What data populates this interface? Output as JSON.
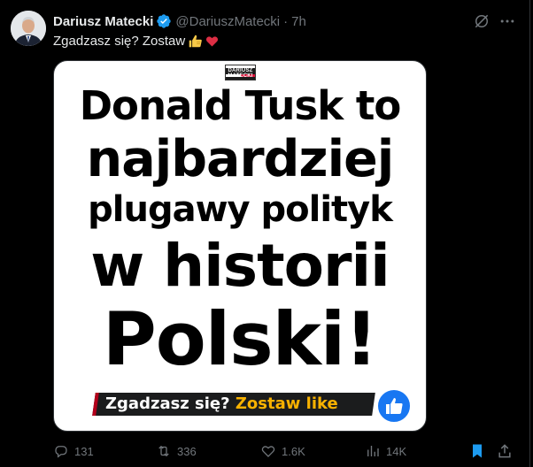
{
  "tweet": {
    "author_name": "Dariusz Matecki",
    "handle": "@DariuszMatecki",
    "separator": "·",
    "time": "7h",
    "text": "Zgadzasz się? Zostaw"
  },
  "media": {
    "logo_text_line1": "DARIUSZ",
    "logo_text_line2": "MATECKI",
    "headline_lines": [
      "Donald Tusk to",
      "najbardziej",
      "plugawy polityk",
      "w historii",
      "Polski!"
    ],
    "banner_part1": "Zgadzasz się?",
    "banner_part2": "Zostaw like"
  },
  "actions": {
    "replies": "131",
    "reposts": "336",
    "likes": "1.6K",
    "views": "14K"
  },
  "colors": {
    "accent": "#1d9bf0",
    "muted": "#71767b",
    "bookmark_active": "#1d9bf0",
    "banner_red": "#b3001b",
    "banner_yellow": "#f9b200"
  },
  "icons": [
    "verified-badge-icon",
    "grok-icon",
    "more-icon",
    "thumbs-up-emoji",
    "heart-emoji",
    "reply-icon",
    "repost-icon",
    "like-icon",
    "views-icon",
    "bookmark-icon",
    "share-icon"
  ]
}
